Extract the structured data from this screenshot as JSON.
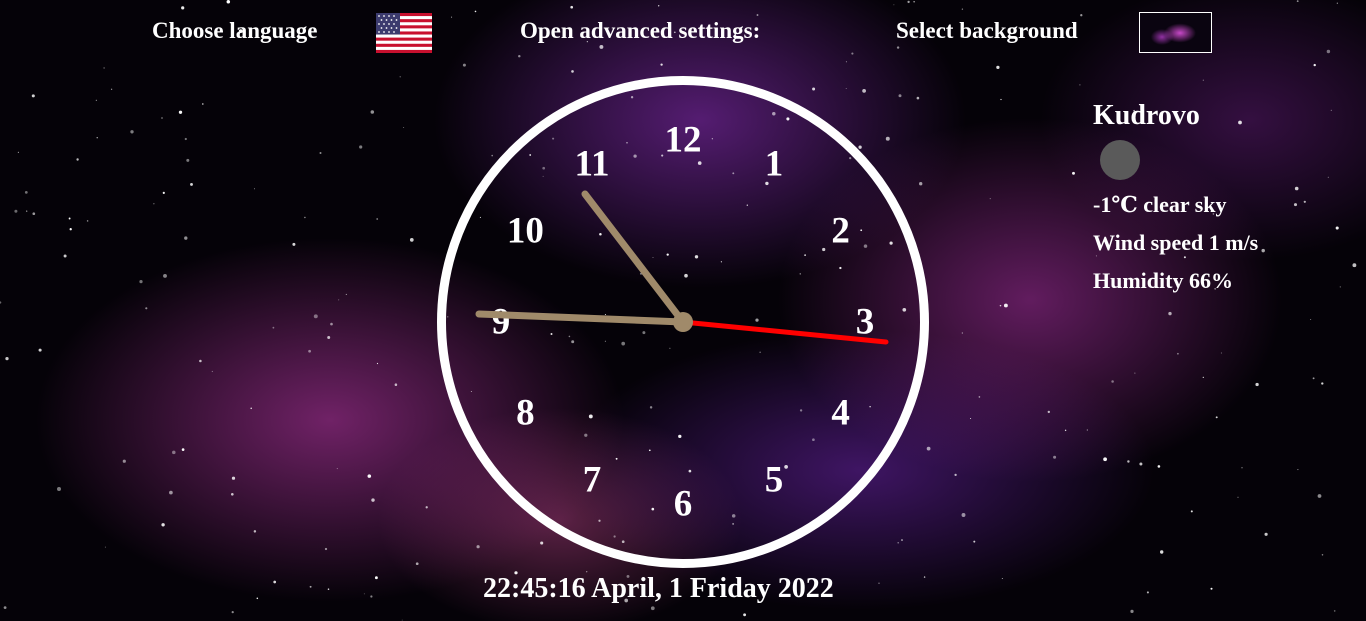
{
  "header": {
    "language_label": "Choose language",
    "language_flag": "us-flag-icon",
    "advanced_label": "Open advanced settings:",
    "background_label": "Select background"
  },
  "clock": {
    "numbers": [
      "12",
      "1",
      "2",
      "3",
      "4",
      "5",
      "6",
      "7",
      "8",
      "9",
      "10",
      "11"
    ],
    "hour_hand_color": "#a08a6a",
    "minute_hand_color": "#a08a6a",
    "second_hand_color": "#ff0000",
    "datetime_text": "22:45:16 April, 1 Friday 2022"
  },
  "weather": {
    "city": "Kudrovo",
    "icon": "moon-icon",
    "temperature_text": "-1℃ clear sky",
    "wind_text": "Wind speed 1 m/s",
    "humidity_text": "Humidity 66%"
  }
}
